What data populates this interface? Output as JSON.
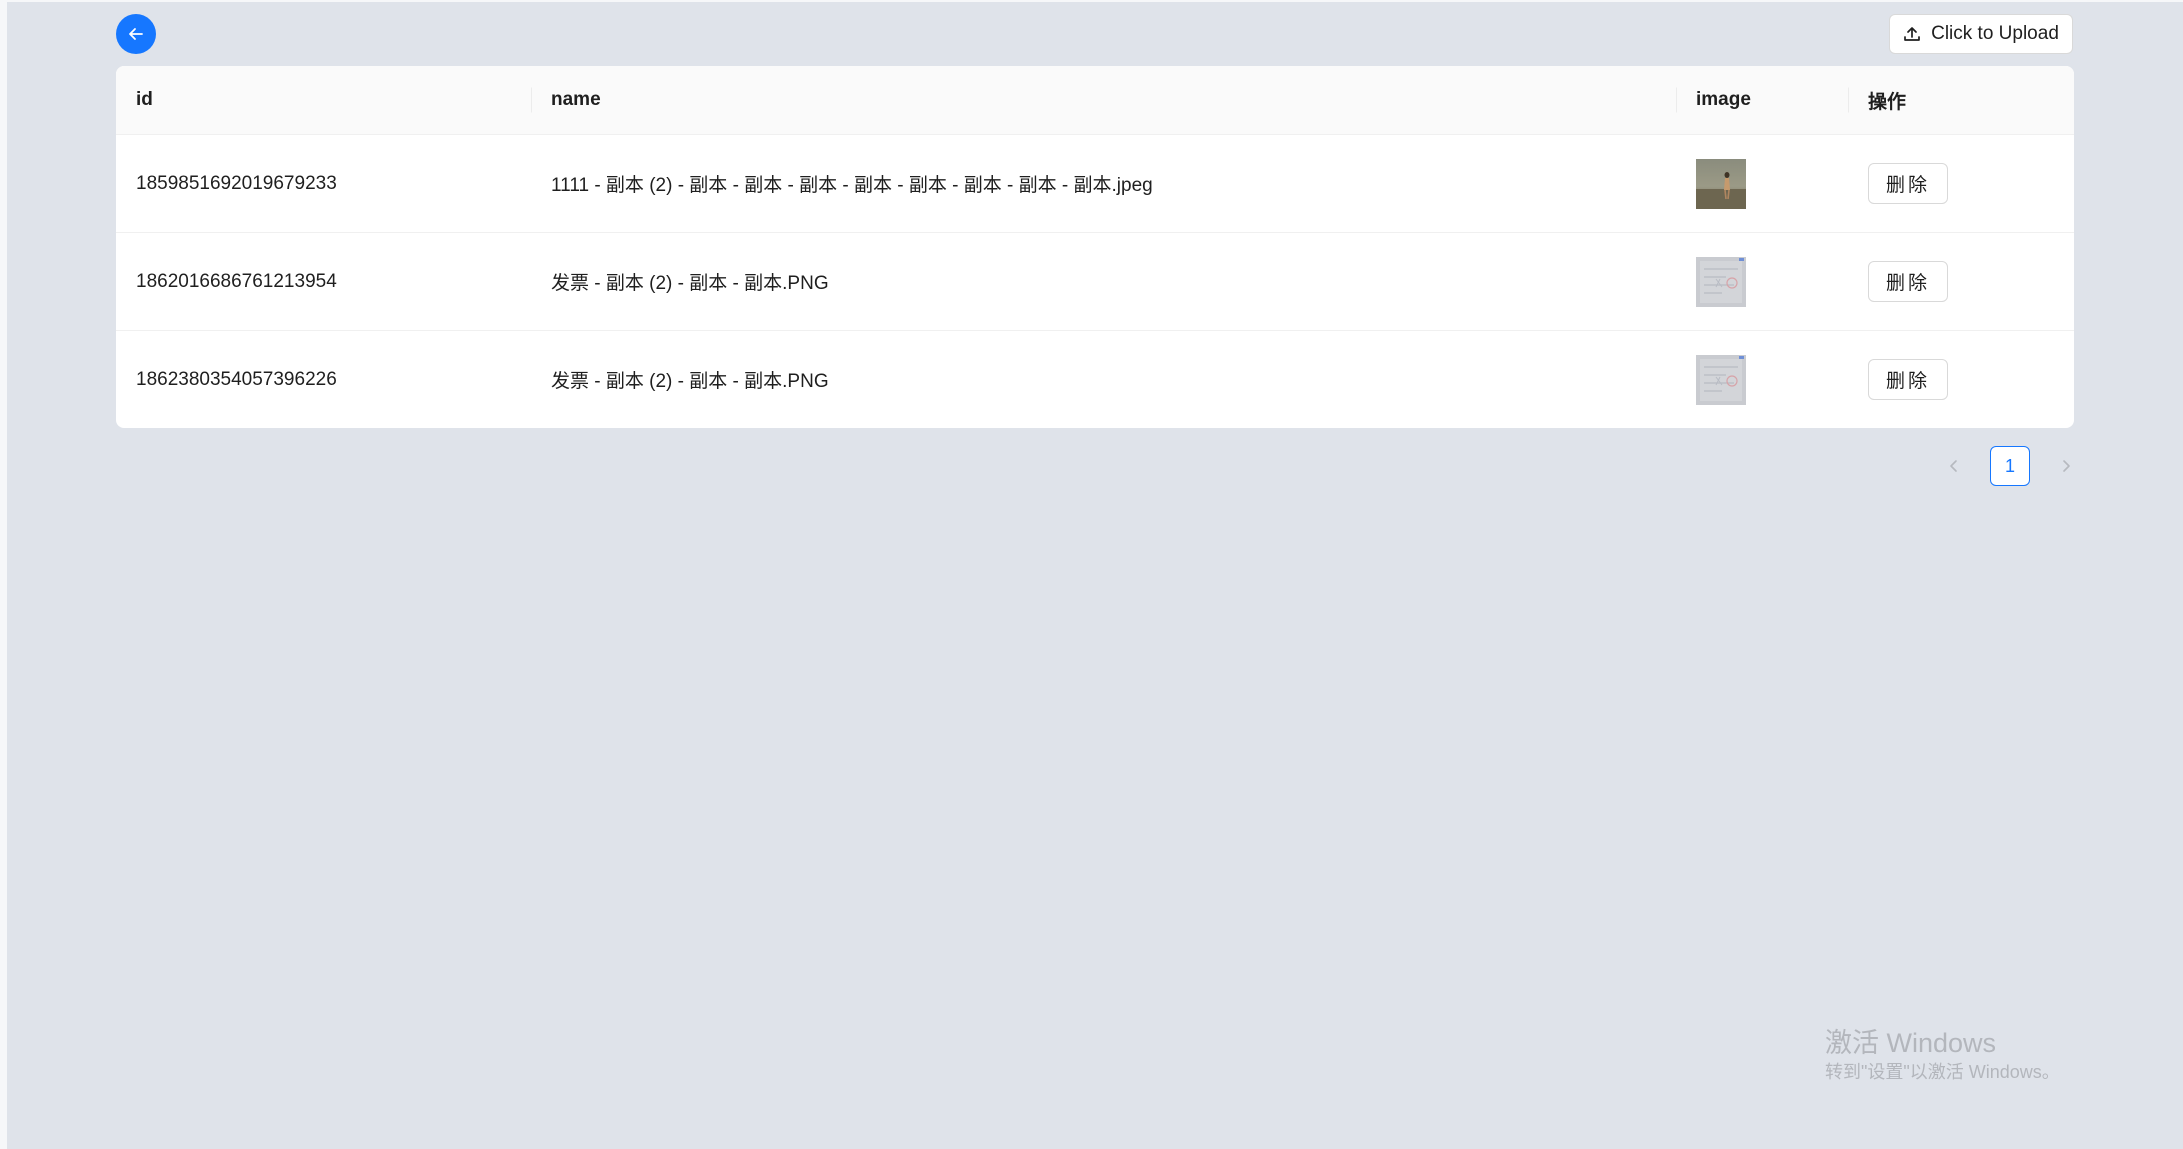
{
  "header": {
    "back_icon": "arrow-left-icon",
    "upload_icon": "upload-icon",
    "upload_label": "Click to Upload",
    "accent_color": "#1677ff"
  },
  "table": {
    "columns": [
      "id",
      "name",
      "image",
      "操作"
    ],
    "rows": [
      {
        "id": "1859851692019679233",
        "name": "1111 - 副本 (2) - 副本 - 副本 - 副本 - 副本 - 副本 - 副本 - 副本 - 副本.jpeg",
        "thumbnail": "photo-thumbnail",
        "action": "删除"
      },
      {
        "id": "1862016686761213954",
        "name": "发票 - 副本 (2) - 副本 - 副本.PNG",
        "thumbnail": "invoice-thumbnail",
        "action": "删除"
      },
      {
        "id": "1862380354057396226",
        "name": "发票 - 副本 (2) - 副本 - 副本.PNG",
        "thumbnail": "invoice-thumbnail",
        "action": "删除"
      }
    ]
  },
  "pagination": {
    "prev_icon": "chevron-left-icon",
    "current_page": "1",
    "next_icon": "chevron-right-icon"
  },
  "watermark": {
    "title": "激活 Windows",
    "subtitle": "转到\"设置\"以激活 Windows。"
  }
}
